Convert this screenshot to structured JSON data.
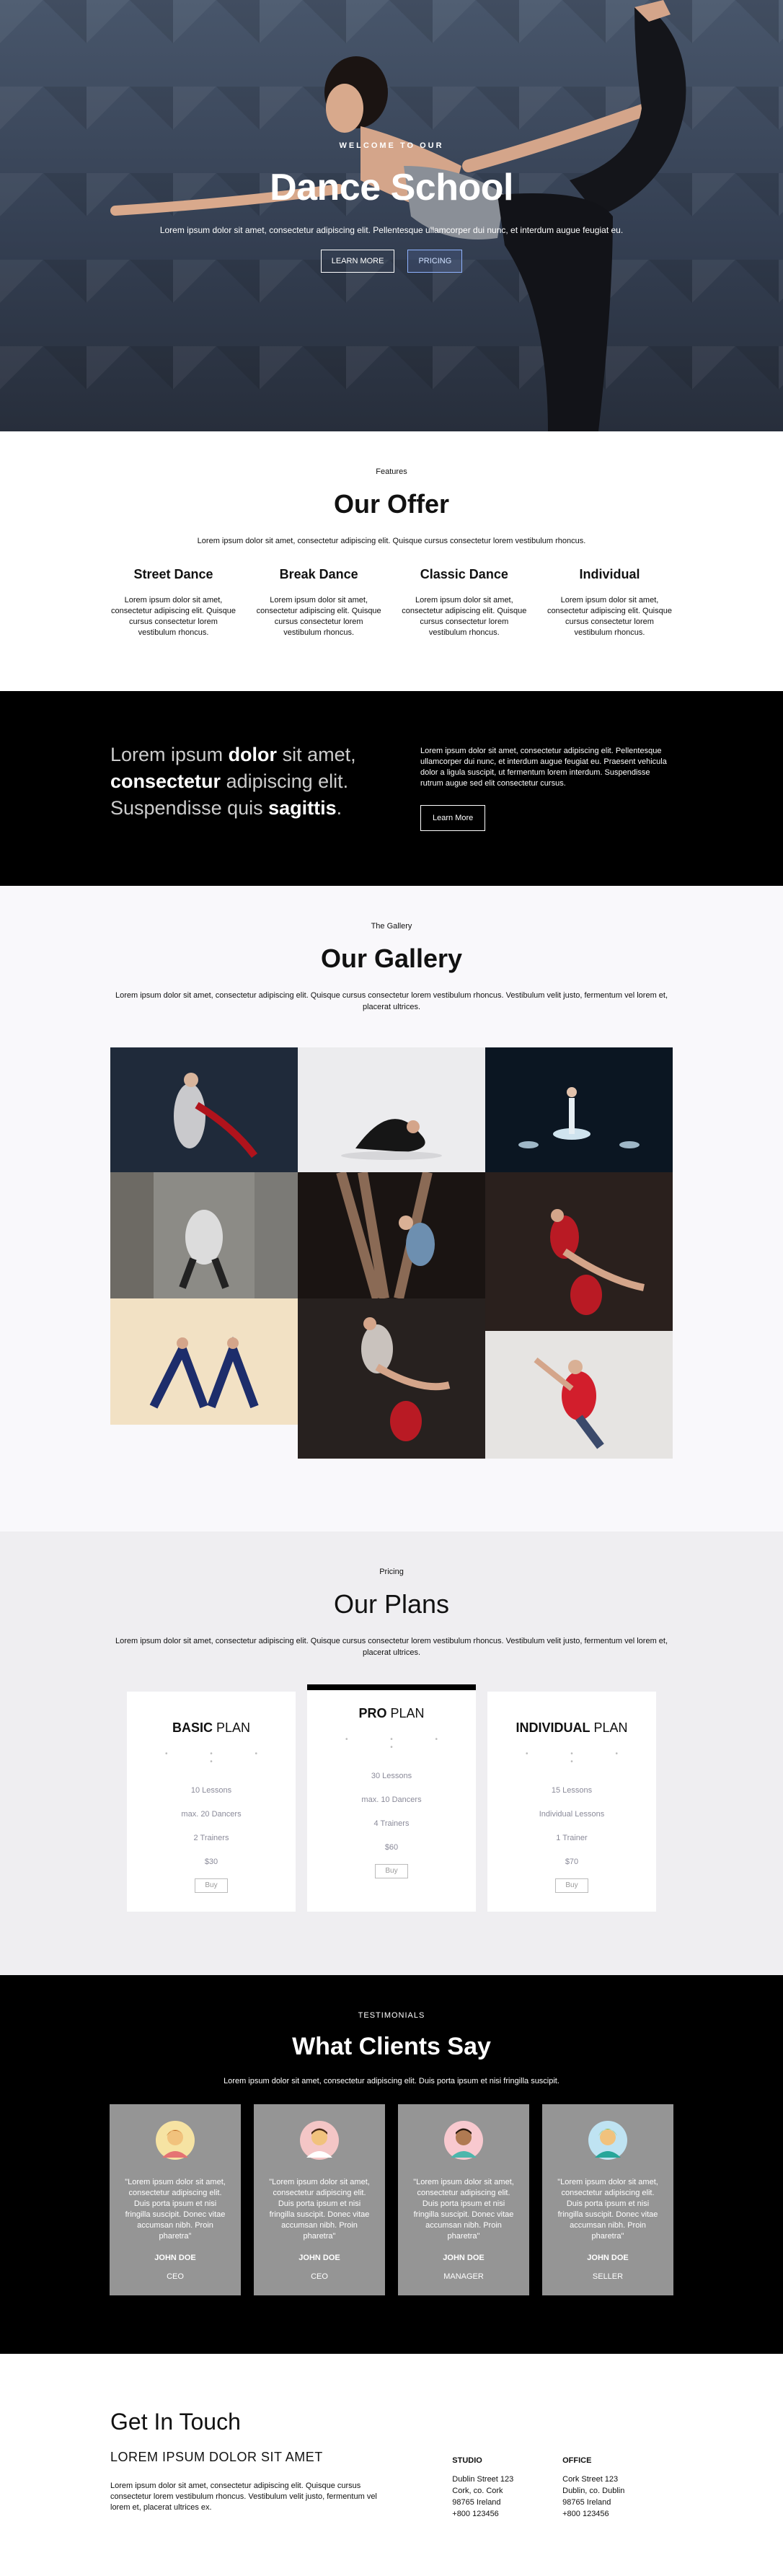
{
  "hero": {
    "kicker": "WELCOME TO OUR",
    "title": "Dance School",
    "lead": "Lorem ipsum dolor sit amet, consectetur adipiscing elit. Pellentesque ullamcorper dui nunc, et interdum augue feugiat eu.",
    "btn_learn": "LEARN MORE",
    "btn_pricing": "PRICING"
  },
  "offer": {
    "kicker": "Features",
    "title": "Our Offer",
    "lead": "Lorem ipsum dolor sit amet, consectetur adipiscing elit. Quisque cursus consectetur lorem vestibulum rhoncus.",
    "features": [
      {
        "title": "Street Dance",
        "text": "Lorem ipsum dolor sit amet, consectetur adipiscing elit. Quisque cursus consectetur lorem vestibulum rhoncus."
      },
      {
        "title": "Break Dance",
        "text": "Lorem ipsum dolor sit amet, consectetur adipiscing elit. Quisque cursus consectetur lorem vestibulum rhoncus."
      },
      {
        "title": "Classic Dance",
        "text": "Lorem ipsum dolor sit amet, consectetur adipiscing elit. Quisque cursus consectetur lorem vestibulum rhoncus."
      },
      {
        "title": "Individual",
        "text": "Lorem ipsum dolor sit amet, consectetur adipiscing elit. Quisque cursus consectetur lorem vestibulum rhoncus."
      }
    ]
  },
  "banner": {
    "q1": "Lorem ipsum ",
    "q2": "dolor",
    "q3": " sit amet, ",
    "q4": "consectetur",
    "q5": " adipiscing elit. Suspendisse quis ",
    "q6": "sagittis",
    "q7": ".",
    "text": "Lorem ipsum dolor sit amet, consectetur adipiscing elit. Pellentesque ullamcorper dui nunc, et interdum augue feugiat eu. Praesent vehicula dolor a ligula suscipit, ut fermentum lorem interdum. Suspendisse rutrum augue sed elit consectetur cursus.",
    "btn": "Learn More"
  },
  "gallery": {
    "kicker": "The Gallery",
    "title": "Our Gallery",
    "lead": "Lorem ipsum dolor sit amet, consectetur adipiscing elit. Quisque cursus consectetur lorem vestibulum rhoncus. Vestibulum velit justo, fermentum vel lorem et, placerat ultrices."
  },
  "plans": {
    "kicker": "Pricing",
    "title": "Our Plans",
    "lead": "Lorem ipsum dolor sit amet, consectetur adipiscing elit. Quisque cursus consectetur lorem vestibulum rhoncus. Vestibulum velit justo, fermentum vel lorem et, placerat ultrices.",
    "dots": "• • • •",
    "cards": [
      {
        "strong": "BASIC",
        "light": " PLAN",
        "items": [
          "10 Lessons",
          "max. 20 Dancers",
          "2 Trainers",
          "$30"
        ],
        "buy": "Buy"
      },
      {
        "strong": "PRO",
        "light": " PLAN",
        "items": [
          "30 Lessons",
          "max. 10 Dancers",
          "4 Trainers",
          "$60"
        ],
        "buy": "Buy"
      },
      {
        "strong": "INDIVIDUAL",
        "light": " PLAN",
        "items": [
          "15 Lessons",
          "Individual Lessons",
          "1 Trainer",
          "$70"
        ],
        "buy": "Buy"
      }
    ]
  },
  "testimonials": {
    "kicker": "TESTIMONIALS",
    "title": "What Clients Say",
    "lead": "Lorem ipsum dolor sit amet, consectetur adipiscing elit. Duis porta ipsum et nisi fringilla suscipit.",
    "items": [
      {
        "quote": "\"Lorem ipsum dolor sit amet, consectetur adipiscing elit. Duis porta ipsum et nisi fringilla suscipit. Donec vitae accumsan nibh. Proin pharetra\"",
        "name": "JOHN DOE",
        "role": "CEO"
      },
      {
        "quote": "\"Lorem ipsum dolor sit amet, consectetur adipiscing elit. Duis porta ipsum et nisi fringilla suscipit. Donec vitae accumsan nibh. Proin pharetra\"",
        "name": "JOHN DOE",
        "role": "CEO"
      },
      {
        "quote": "\"Lorem ipsum dolor sit amet, consectetur adipiscing elit. Duis porta ipsum et nisi fringilla suscipit. Donec vitae accumsan nibh. Proin pharetra\"",
        "name": "JOHN DOE",
        "role": "MANAGER"
      },
      {
        "quote": "\"Lorem ipsum dolor sit amet, consectetur adipiscing elit. Duis porta ipsum et nisi fringilla suscipit. Donec vitae accumsan nibh. Proin pharetra\"",
        "name": "JOHN DOE",
        "role": "SELLER"
      }
    ]
  },
  "contact": {
    "title": "Get In Touch",
    "subtitle": "LOREM IPSUM DOLOR SIT AMET",
    "text": "Lorem ipsum dolor sit amet, consectetur adipiscing elit. Quisque cursus consectetur lorem vestibulum rhoncus. Vestibulum velit justo, fermentum vel lorem et, placerat ultrices ex.",
    "studio": {
      "label": "STUDIO",
      "l1": "Dublin Street 123",
      "l2": "Cork, co. Cork",
      "l3": "98765 Ireland",
      "l4": "+800 123456"
    },
    "office": {
      "label": "OFFICE",
      "l1": "Cork Street 123",
      "l2": "Dublin, co. Dublin",
      "l3": "98765 Ireland",
      "l4": "+800 123456"
    }
  }
}
